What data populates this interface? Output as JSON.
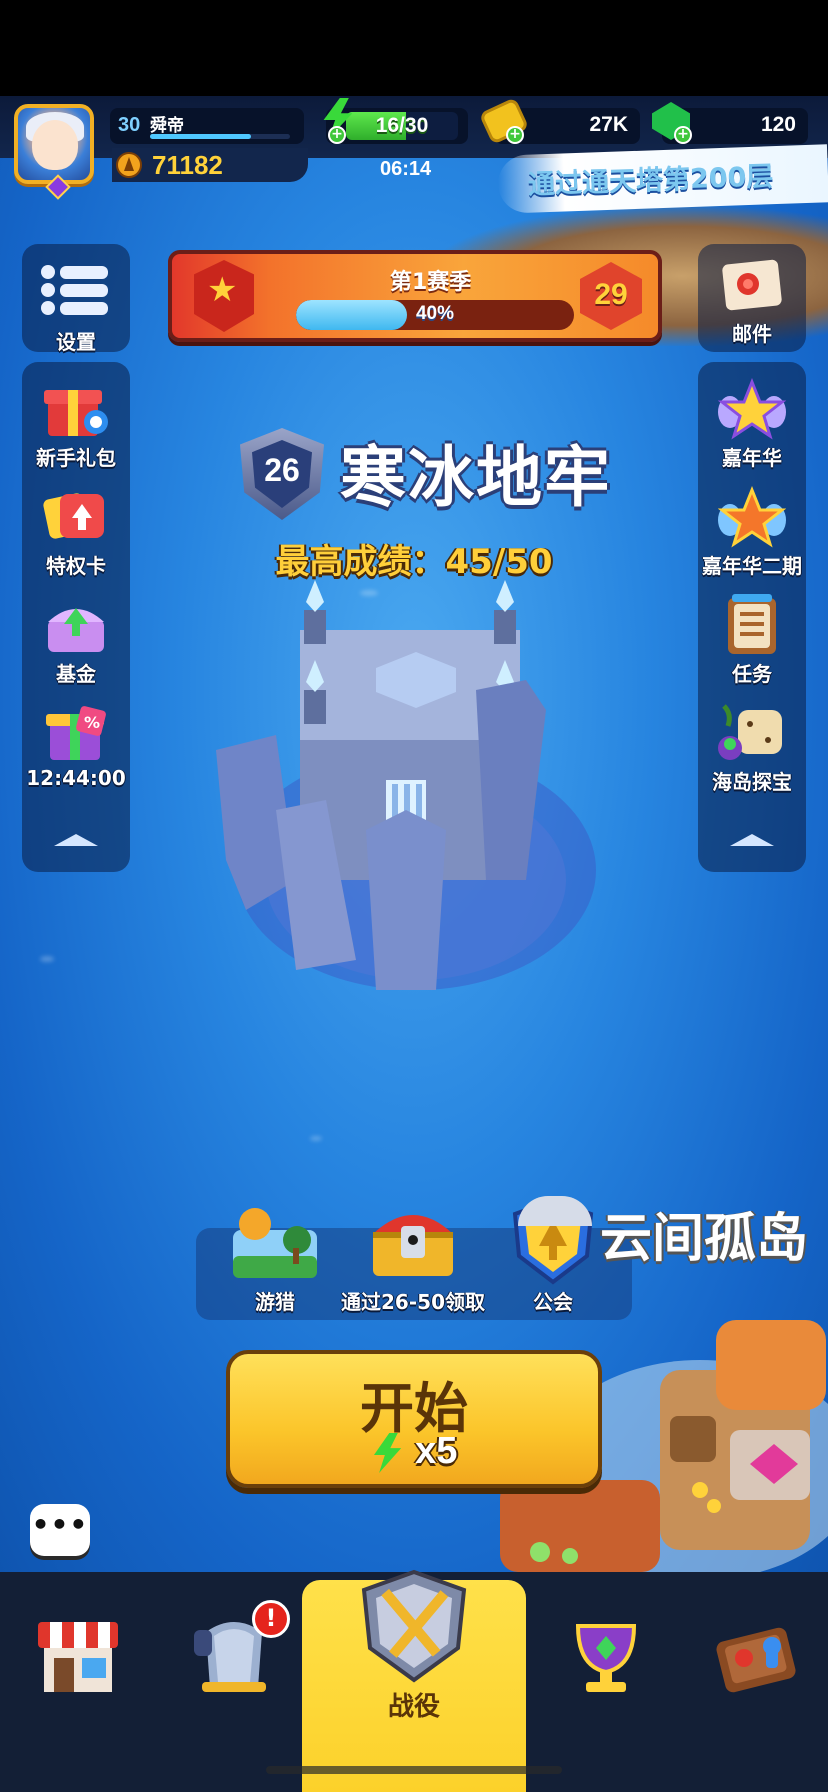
{
  "player": {
    "level": "30",
    "name": "舜帝",
    "xp_fraction": 0.72,
    "power": "71182"
  },
  "resources": {
    "energy_text": "16/30",
    "energy_fraction": 0.533,
    "energy_timer": "06:14",
    "coins": "27K",
    "gems": "120"
  },
  "banner": {
    "tower_text": "通过通天塔第200层"
  },
  "season": {
    "title": "第1赛季",
    "progress_text": "40%",
    "progress": 0.4,
    "level": "29"
  },
  "left_menu": {
    "settings_label": "设置",
    "items": [
      {
        "label": "新手礼包",
        "icon": "gift-box-icon"
      },
      {
        "label": "特权卡",
        "icon": "privilege-card-icon"
      },
      {
        "label": "基金",
        "icon": "fund-chest-icon"
      },
      {
        "label": "12:44:00",
        "icon": "discount-gift-icon"
      }
    ]
  },
  "right_menu": {
    "mail_label": "邮件",
    "items": [
      {
        "label": "嘉年华",
        "icon": "star-wings-icon"
      },
      {
        "label": "嘉年华二期",
        "icon": "star-wings-orange-icon"
      },
      {
        "label": "任务",
        "icon": "task-scroll-icon"
      },
      {
        "label": "海岛探宝",
        "icon": "island-treasure-icon"
      }
    ]
  },
  "stage": {
    "number": "26",
    "name": "寒冰地牢",
    "best_score": "最高成绩：45/50"
  },
  "actions": {
    "hunt_label": "游猎",
    "chest_label": "通过26-50领取",
    "guild_label": "公会",
    "next_island": "云间孤岛"
  },
  "start": {
    "label": "开始",
    "cost": "x5"
  },
  "nav": {
    "battle_label": "战役",
    "alert": "!"
  },
  "colors": {
    "accent_yellow": "#fcd12a",
    "energy_green": "#39d93a",
    "ocean_blue": "#2785e0",
    "season_orange": "#f9a53b"
  }
}
